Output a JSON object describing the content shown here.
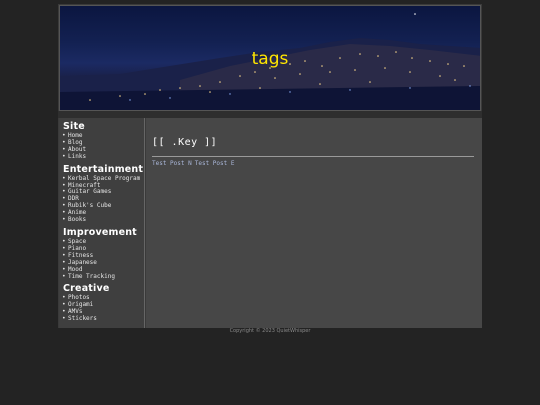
{
  "banner": {
    "title": "tags"
  },
  "sidebar": {
    "sections": [
      {
        "title": "Site",
        "items": [
          "Home",
          "Blog",
          "About",
          "Links"
        ]
      },
      {
        "title": "Entertainment",
        "items": [
          "Kerbal Space Program",
          "Minecraft",
          "Guitar Games",
          "DDR",
          "Rubik's Cube",
          "Anime",
          "Books"
        ]
      },
      {
        "title": "Improvement",
        "items": [
          "Space",
          "Piano",
          "Fitness",
          "Japanese",
          "Mood",
          "Time Tracking"
        ]
      },
      {
        "title": "Creative",
        "items": [
          "Photos",
          "Origami",
          "AMVs",
          "Stickers"
        ]
      }
    ]
  },
  "main": {
    "title": "[[ .Key ]]",
    "posts": [
      "Test Post N",
      "Test Post E"
    ]
  },
  "footer": {
    "text": "Copyright © 2023 QuietWhisper"
  },
  "colors": {
    "background": "#232323",
    "banner_title": "#ffe600",
    "post_link": "#a9b6d8"
  }
}
